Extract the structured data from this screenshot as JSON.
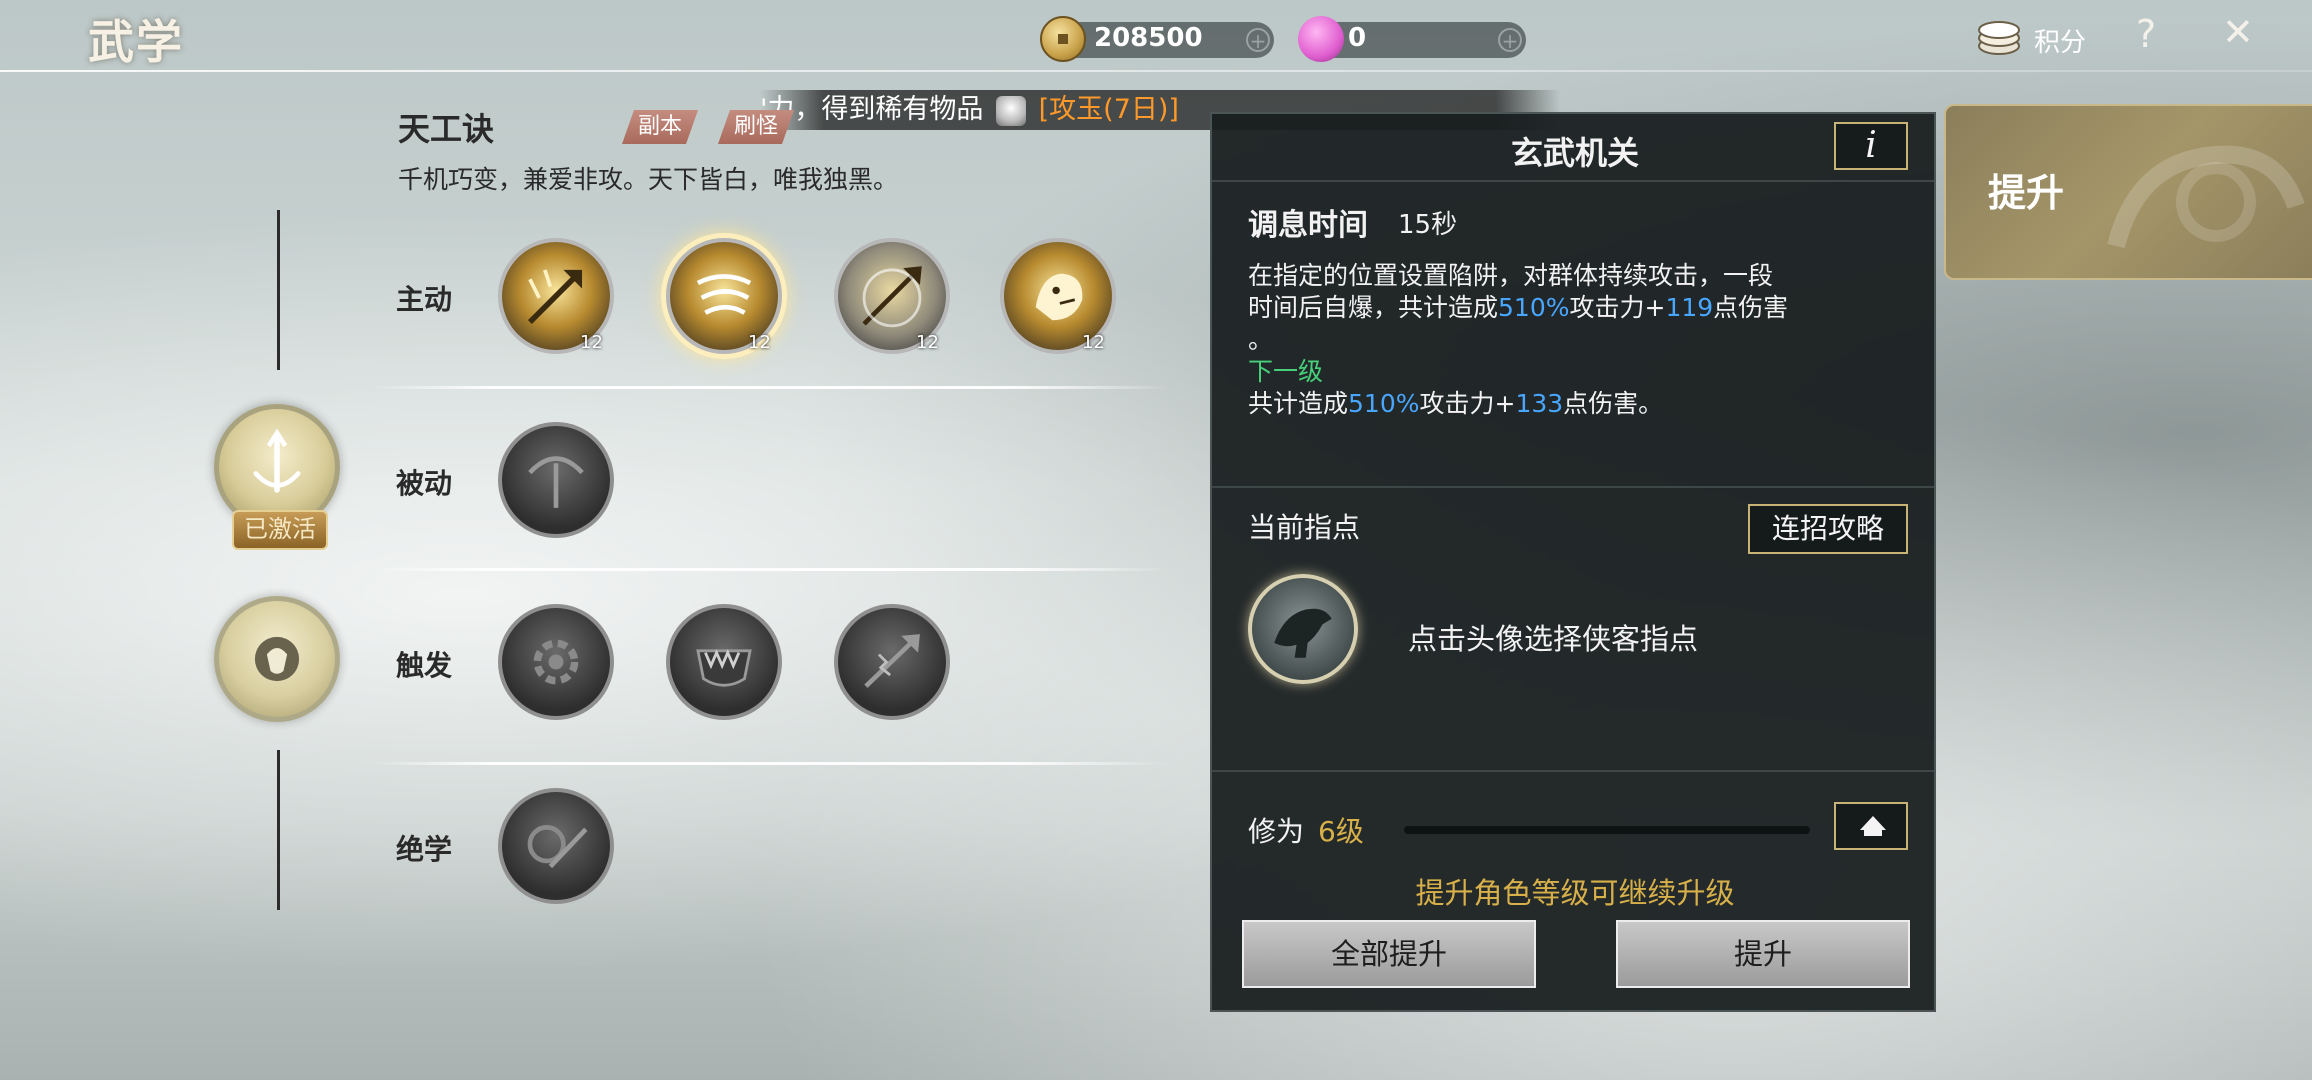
{
  "header": {
    "title": "武学",
    "coins": "208500",
    "gems": "0",
    "points_label": "积分",
    "help_icon": "?",
    "close_icon": "✕"
  },
  "marquee": {
    "text": "'力，得到稀有物品",
    "item": "[攻玉(7日)]"
  },
  "book": {
    "name": "天工诀",
    "tags": [
      "副本",
      "刷怪"
    ],
    "description": "千机巧变，兼爱非攻。天下皆白，唯我独黑。"
  },
  "rows": {
    "active": "主动",
    "passive": "被动",
    "trigger": "触发",
    "ultimate": "绝学"
  },
  "skills": {
    "active_levels": [
      "12",
      "12",
      "12",
      "12"
    ]
  },
  "activated_badge": "已激活",
  "detail": {
    "name": "玄武机关",
    "info_icon": "i",
    "cooldown_label": "调息时间",
    "cooldown_value": "15秒",
    "desc_part1": "在指定的位置设置陷阱，对群体持续攻击，一段",
    "desc_part2a": "时间后自爆，共计造成",
    "desc_pct": "510%",
    "desc_part2b": "攻击力+",
    "desc_dmg": "119",
    "desc_part2c": "点伤害",
    "desc_part3": "。",
    "next_level_label": "下一级",
    "next_part1": "共计造成",
    "next_pct": "510%",
    "next_part2": "攻击力+",
    "next_dmg": "133",
    "next_part3": "点伤害。",
    "guide_title": "当前指点",
    "combo_button": "连招攻略",
    "guide_hint": "点击头像选择侠客指点",
    "cultivation_label": "修为",
    "cultivation_value": "6级",
    "level_hint": "提升角色等级可继续升级",
    "upgrade_all_button": "全部提升",
    "upgrade_button": "提升"
  },
  "side_tab": "提升",
  "colors": {
    "gold": "#d8b04a",
    "blue_value": "#49a6ff",
    "green_label": "#47d07a",
    "marquee_item": "#ff9a2a"
  }
}
